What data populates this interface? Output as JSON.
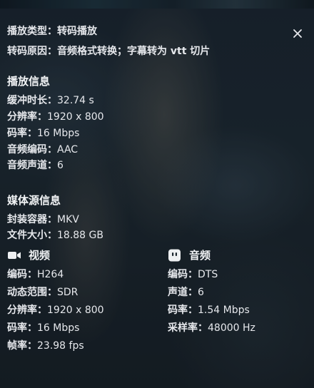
{
  "header": {
    "play_type": {
      "label": "播放类型：",
      "value": "转码播放"
    },
    "transcode_reason": {
      "label": "转码原因：",
      "value": "音频格式转换；字幕转为 vtt 切片"
    }
  },
  "close_icon": "close-icon",
  "playback": {
    "title": "播放信息",
    "rows": [
      {
        "label": "缓冲时长：",
        "value": "32.74 s"
      },
      {
        "label": "分辨率：",
        "value": "1920 x 800"
      },
      {
        "label": "码率：",
        "value": "16 Mbps"
      },
      {
        "label": "音频编码：",
        "value": "AAC"
      },
      {
        "label": "音频声道：",
        "value": "6"
      }
    ]
  },
  "media_source": {
    "title": "媒体源信息",
    "rows": [
      {
        "label": "封装容器：",
        "value": "MKV"
      },
      {
        "label": "文件大小：",
        "value": "18.88 GB"
      }
    ],
    "video": {
      "title": "视频",
      "icon": "video-camera-icon",
      "rows": [
        {
          "label": "编码：",
          "value": "H264"
        },
        {
          "label": "动态范围：",
          "value": "SDR"
        },
        {
          "label": "分辨率：",
          "value": "1920 x 800"
        },
        {
          "label": "码率：",
          "value": "16 Mbps"
        },
        {
          "label": "帧率：",
          "value": "23.98 fps"
        }
      ]
    },
    "audio": {
      "title": "音频",
      "icon": "audio-icon",
      "rows": [
        {
          "label": "编码：",
          "value": "DTS"
        },
        {
          "label": "声道：",
          "value": "6"
        },
        {
          "label": "码率：",
          "value": "1.54 Mbps"
        },
        {
          "label": "采样率：",
          "value": "48000 Hz"
        }
      ]
    }
  }
}
